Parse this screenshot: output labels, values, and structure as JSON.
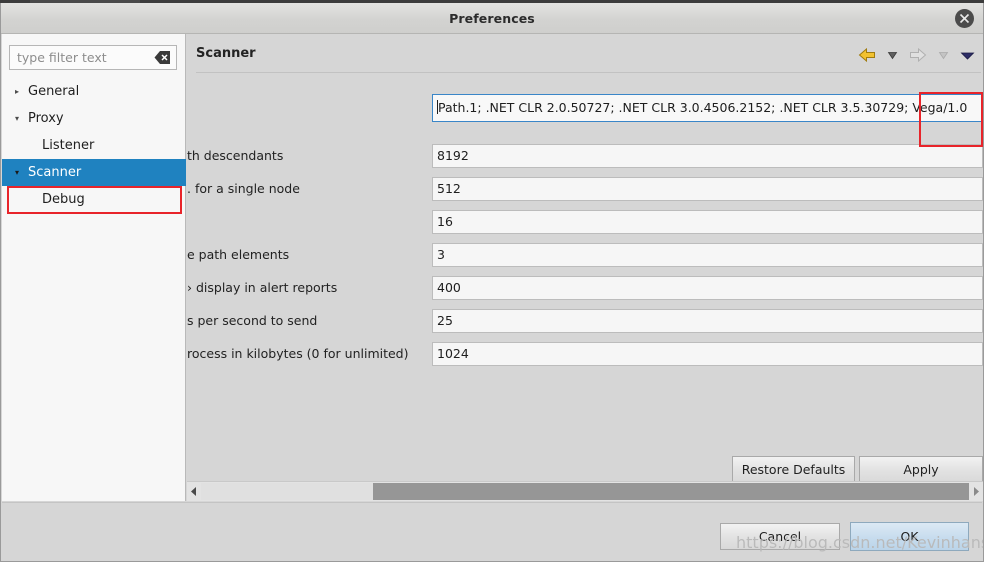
{
  "window": {
    "title": "Preferences",
    "close_icon": "close-icon"
  },
  "sidebar": {
    "filter": {
      "placeholder": "type filter text",
      "value": "",
      "clear_icon": "clear-filter-icon"
    },
    "items": [
      {
        "label": "General",
        "level": 0,
        "expanded": false,
        "arrow": "▸",
        "selected": false
      },
      {
        "label": "Proxy",
        "level": 0,
        "expanded": true,
        "arrow": "▾",
        "selected": false
      },
      {
        "label": "Listener",
        "level": 1,
        "expanded": null,
        "arrow": "",
        "selected": false
      },
      {
        "label": "Scanner",
        "level": 0,
        "expanded": true,
        "arrow": "▾",
        "selected": true
      },
      {
        "label": "Debug",
        "level": 1,
        "expanded": null,
        "arrow": "",
        "selected": false
      }
    ]
  },
  "content": {
    "page_title": "Scanner",
    "toolbar": [
      {
        "name": "back-arrow-icon",
        "enabled": true
      },
      {
        "name": "back-dropdown-icon",
        "enabled": true
      },
      {
        "name": "forward-arrow-icon",
        "enabled": false
      },
      {
        "name": "forward-dropdown-icon",
        "enabled": false
      },
      {
        "name": "menu-chevron-down-icon",
        "enabled": true
      }
    ],
    "fields": [
      {
        "label": "",
        "value": "Path.1; .NET CLR 2.0.50727; .NET CLR 3.0.4506.2152; .NET CLR 3.5.30729; Vega/1.0",
        "focused": true
      },
      {
        "label": "th descendants",
        "value": "8192",
        "focused": false
      },
      {
        "label": ". for a single node",
        "value": "512",
        "focused": false
      },
      {
        "label": "",
        "value": "16",
        "focused": false
      },
      {
        "label": "e path elements",
        "value": "3",
        "focused": false
      },
      {
        "label": "› display in alert reports",
        "value": "400",
        "focused": false
      },
      {
        "label": "s per second to send",
        "value": "25",
        "focused": false
      },
      {
        "label": "rocess in kilobytes (0 for unlimited)",
        "value": "1024",
        "focused": false
      }
    ],
    "restore_defaults_label": "Restore Defaults",
    "apply_label": "Apply"
  },
  "scrollbar": {
    "left_arrow_icon": "scroll-left-icon",
    "right_arrow_icon": "scroll-right-icon"
  },
  "dialog_buttons": {
    "cancel_label": "Cancel",
    "ok_label": "OK"
  },
  "watermark": "https://blog.csdn.net/Kevinhanser",
  "colors": {
    "selection_blue": "#1f82c0",
    "annotation_red": "#e8242a",
    "focus_border": "#3a86c8",
    "window_bg": "#d6d6d6",
    "sidebar_bg": "#f7f7f7",
    "ok_button_blue": "#c7dcee"
  }
}
